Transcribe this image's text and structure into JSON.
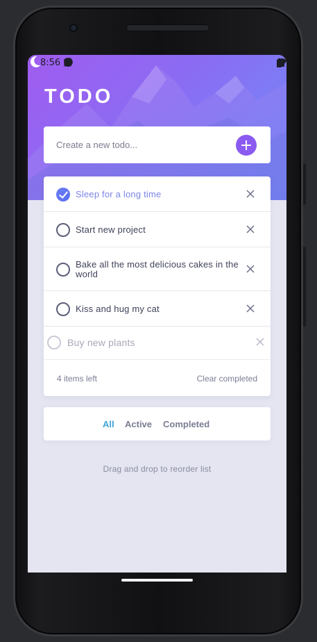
{
  "status_bar": {
    "time": "8:56",
    "left_icons": [
      "shield-icon",
      "sd-card-icon",
      "notification-icon"
    ],
    "right_icons": [
      "wifi-icon",
      "signal-icon",
      "battery-icon"
    ]
  },
  "header": {
    "title": "TODO",
    "theme_toggle_icon": "moon-icon"
  },
  "create": {
    "placeholder": "Create a new todo...",
    "value": "",
    "add_label": "+"
  },
  "todos": [
    {
      "text": "Sleep for a long time",
      "completed": true
    },
    {
      "text": "Start new project",
      "completed": false
    },
    {
      "text": "Bake all the most delicious cakes in the world",
      "completed": false
    },
    {
      "text": "Kiss and hug my cat",
      "completed": false
    },
    {
      "text": "Buy new plants",
      "completed": false,
      "dragging": true
    }
  ],
  "footer": {
    "items_left": "4 items left",
    "clear_completed": "Clear completed"
  },
  "filters": {
    "all": "All",
    "active": "Active",
    "completed": "Completed",
    "selected": "All"
  },
  "hint": "Drag and drop to reorder list",
  "colors": {
    "accent": "#8b5af0",
    "check_gradient": "#6a7ef6",
    "active_filter": "#3fa4d8",
    "background": "#e4e5f1"
  }
}
